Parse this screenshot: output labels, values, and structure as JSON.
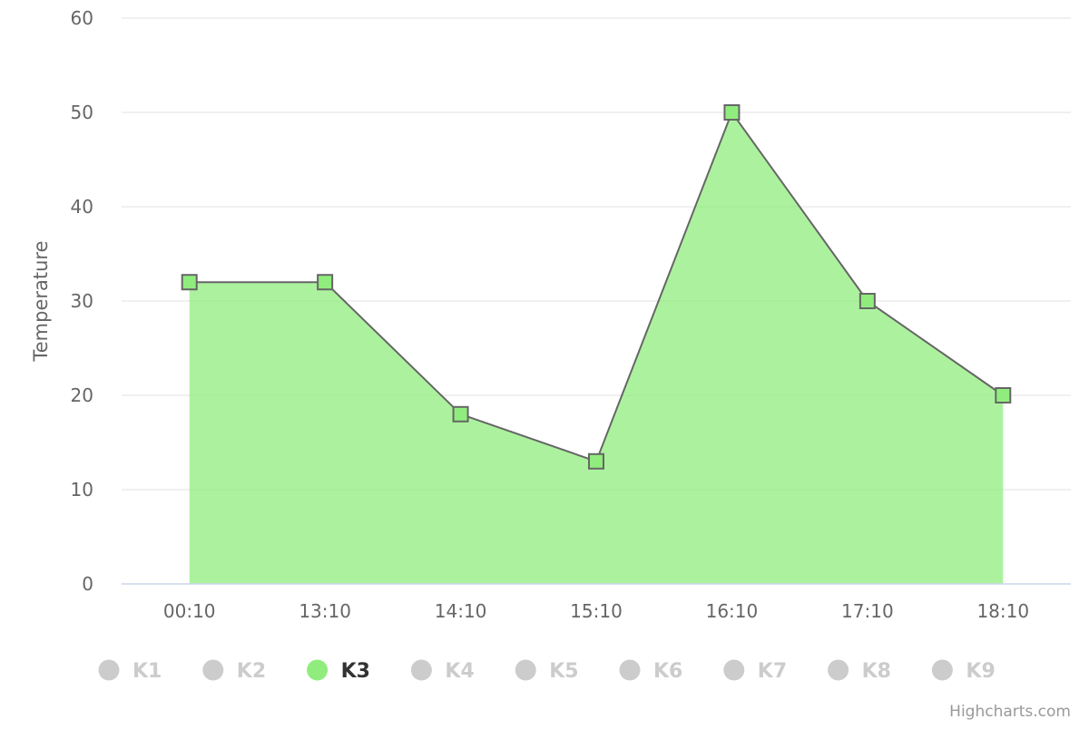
{
  "chart_data": {
    "type": "area",
    "ylabel": "Temperature",
    "xlabel": "",
    "ylim": [
      0,
      60
    ],
    "yticks": [
      0,
      10,
      20,
      30,
      40,
      50,
      60
    ],
    "categories": [
      "00:10",
      "13:10",
      "14:10",
      "15:10",
      "16:10",
      "17:10",
      "18:10"
    ],
    "series": [
      {
        "name": "K3",
        "values": [
          32,
          32,
          18,
          13,
          50,
          30,
          20
        ],
        "visible": true,
        "color": "#90ed7d"
      }
    ],
    "legend": {
      "position": "bottom",
      "items": [
        {
          "name": "K1",
          "visible": false
        },
        {
          "name": "K2",
          "visible": false
        },
        {
          "name": "K3",
          "visible": true
        },
        {
          "name": "K4",
          "visible": false
        },
        {
          "name": "K5",
          "visible": false
        },
        {
          "name": "K6",
          "visible": false
        },
        {
          "name": "K7",
          "visible": false
        },
        {
          "name": "K8",
          "visible": false
        },
        {
          "name": "K9",
          "visible": false
        }
      ]
    },
    "grid": true,
    "credits": "Highcharts.com"
  },
  "colors": {
    "area_fill": "#90ed7d",
    "line": "#666666",
    "hidden_legend": "#cccccc",
    "active_legend_text": "#333333",
    "gridline": "#e6e6e6",
    "axis_line": "#ccd6eb"
  }
}
